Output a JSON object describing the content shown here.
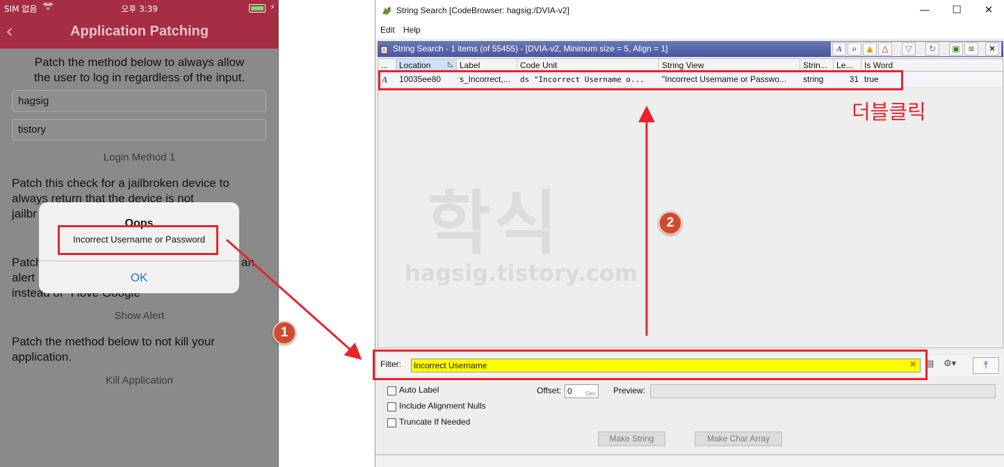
{
  "phone": {
    "status": {
      "carrier": "SIM 없음",
      "time": "오후 3:39"
    },
    "nav": {
      "back_glyph": "‹",
      "title": "Application Patching"
    },
    "section1": {
      "line1": "Patch the method below to always allow",
      "line2": "the user to log in regardless of the input."
    },
    "username_value": "hagsig",
    "password_value": "tistory",
    "login_button": "Login Method 1",
    "section2": {
      "line1": "Patch this check for a jailbroken device to",
      "line2": "always return that the device is not",
      "line3": "jailbr"
    },
    "section3": {
      "line1": "Patch",
      "line1_tail": "an",
      "line2": "alert",
      "line3": "instead of \"I love Google\""
    },
    "show_alert_button": "Show Alert",
    "section4": {
      "line1": "Patch the method below to not kill your",
      "line2": "application."
    },
    "kill_button": "Kill Application",
    "alert": {
      "title": "Oops",
      "message": "Incorrect Username or Password",
      "ok": "OK"
    }
  },
  "ghidra": {
    "window_title": "String Search [CodeBrowser: hagsig:/DVIA-v2]",
    "window_buttons": {
      "minimize": "—",
      "maximize": "☐",
      "close": "✕"
    },
    "menu": {
      "edit": "Edit",
      "help": "Help"
    },
    "panel_title": "String Search - 1 items (of 55455) - [DVIA-v2, Minimum size = 5, Align = 1]",
    "toolbar_icons": [
      "defined-string-icon",
      "search-icon",
      "warning-icon",
      "error-icon",
      "filter-icon",
      "refresh-icon",
      "select-icon",
      "columns-icon",
      "close-icon"
    ],
    "columns": [
      "...",
      "Location",
      "Label",
      "Code Unit",
      "String View",
      "Strin...",
      "Le...",
      "Is Word"
    ],
    "rows": [
      {
        "location": "10035ee80",
        "label": "s_Incorrect,...",
        "code_unit": "ds \"Incorrect Username o...",
        "string_view": "\"Incorrect Username or Passwo...",
        "string_type": "string",
        "length": "31",
        "is_word": "true"
      }
    ],
    "filter_label": "Filter:",
    "filter_value": "Incorrect Username",
    "options": {
      "auto_label": "Auto Label",
      "include_alignment_nulls": "Include Alignment Nulls",
      "truncate_if_needed": "Truncate If Needed",
      "offset_label": "Offset:",
      "offset_value": "0",
      "offset_unit": "Dec",
      "preview_label": "Preview:"
    },
    "make_string": "Make String",
    "make_char_array": "Make Char Array"
  },
  "annotations": {
    "double_click": "더블클릭",
    "marker1": "1",
    "marker2": "2",
    "color": "#e8232a"
  },
  "watermark": {
    "title": "학식",
    "url": "hagsig.tistory.com"
  }
}
